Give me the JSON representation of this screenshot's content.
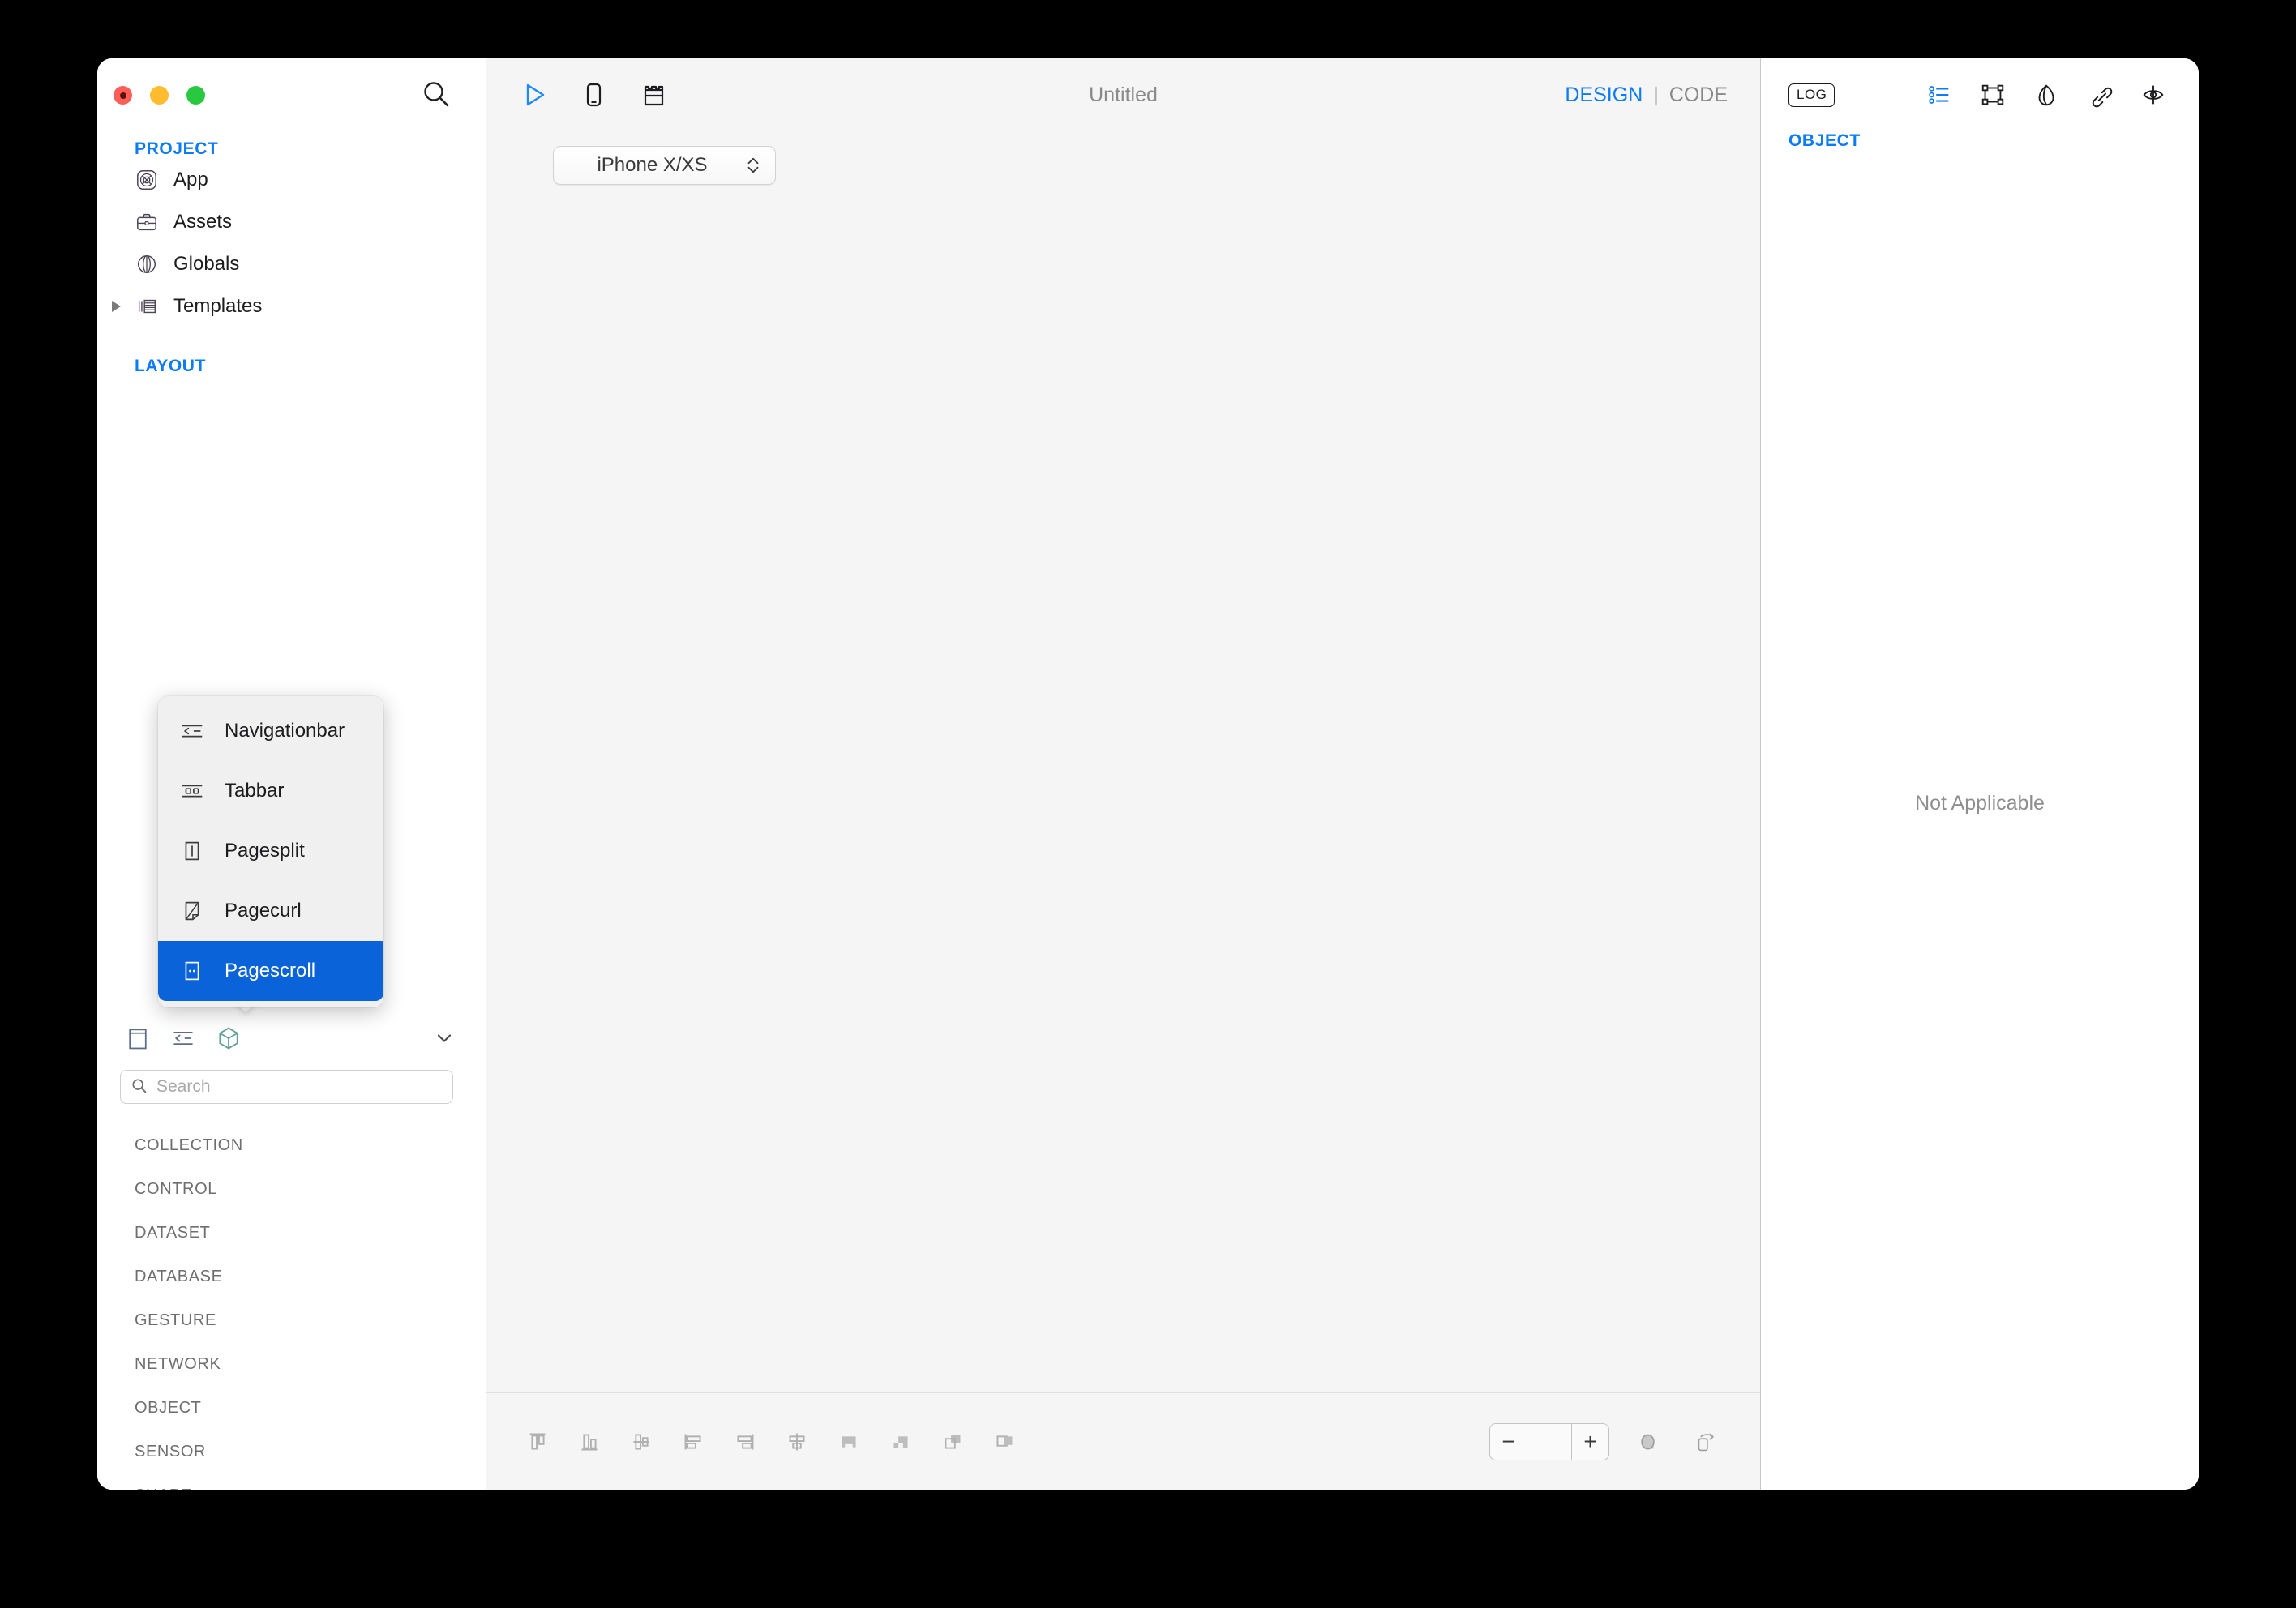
{
  "window": {
    "traffic_lights": [
      "close",
      "minimize",
      "zoom"
    ]
  },
  "sidebar": {
    "search_icon": "search-icon",
    "sections": [
      {
        "label": "PROJECT",
        "items": [
          {
            "label": "App",
            "icon": "app-icon",
            "disclosure": false
          },
          {
            "label": "Assets",
            "icon": "briefcase-icon",
            "disclosure": false
          },
          {
            "label": "Globals",
            "icon": "globe-icon",
            "disclosure": false
          },
          {
            "label": "Templates",
            "icon": "templates-icon",
            "disclosure": true
          }
        ]
      },
      {
        "label": "LAYOUT",
        "items": []
      }
    ]
  },
  "context_menu": {
    "items": [
      {
        "label": "Navigationbar",
        "icon": "navigationbar-icon",
        "selected": false
      },
      {
        "label": "Tabbar",
        "icon": "tabbar-icon",
        "selected": false
      },
      {
        "label": "Pagesplit",
        "icon": "pagesplit-icon",
        "selected": false
      },
      {
        "label": "Pagecurl",
        "icon": "pagecurl-icon",
        "selected": false
      },
      {
        "label": "Pagescroll",
        "icon": "pagescroll-icon",
        "selected": true
      }
    ],
    "highlight_color": "#0a63d8"
  },
  "library": {
    "tabs": [
      {
        "name": "page-tab",
        "icon": "page-icon"
      },
      {
        "name": "navigationbar-tab",
        "icon": "navigationbar-icon"
      },
      {
        "name": "object-tab",
        "icon": "cube-icon"
      }
    ],
    "collapse_icon": "chevron-down-icon",
    "search": {
      "value": "",
      "placeholder": "Search",
      "icon": "search-icon"
    },
    "categories": [
      "COLLECTION",
      "CONTROL",
      "DATASET",
      "DATABASE",
      "GESTURE",
      "NETWORK",
      "OBJECT",
      "SENSOR",
      "SHAPE"
    ]
  },
  "canvas": {
    "toolbar_icons": [
      {
        "name": "run-icon",
        "color": "#1f8bfb"
      },
      {
        "name": "device-preview-icon",
        "color": "#1d1d1f"
      },
      {
        "name": "components-icon",
        "color": "#1d1d1f"
      }
    ],
    "title": "Untitled",
    "modes": {
      "design": "DESIGN",
      "separator": "|",
      "code": "CODE",
      "active": "DESIGN"
    },
    "device": {
      "value": "iPhone X/XS",
      "stepper_icon": "up-down-arrows-icon"
    },
    "align_tools": [
      "align-top-icon",
      "align-bottom-icon",
      "align-vertical-center-icon",
      "align-left-icon",
      "align-right-icon",
      "align-horizontal-center-icon",
      "distribute-horizontal-icon",
      "distribute-vertical-icon",
      "bring-forward-icon",
      "send-backward-icon"
    ],
    "zoom": {
      "value": "",
      "minus": "−",
      "plus": "+"
    },
    "zoom_extra_icons": [
      "fit-icon",
      "rotate-device-icon"
    ]
  },
  "inspector": {
    "log_badge": "LOG",
    "icons": [
      {
        "name": "list-properties-icon",
        "color": "#0b7bf7"
      },
      {
        "name": "bounds-icon",
        "color": "#1d1d1f"
      },
      {
        "name": "style-icon",
        "color": "#1d1d1f"
      },
      {
        "name": "link-icon",
        "color": "#1d1d1f"
      },
      {
        "name": "visibility-icon",
        "color": "#1d1d1f"
      }
    ],
    "section_label": "OBJECT",
    "empty_state": "Not Applicable"
  },
  "colors": {
    "accent": "#0b7bf7",
    "selection": "#0a63d8",
    "canvas_bg": "#f5f5f5",
    "panel_bg": "#ffffff"
  }
}
